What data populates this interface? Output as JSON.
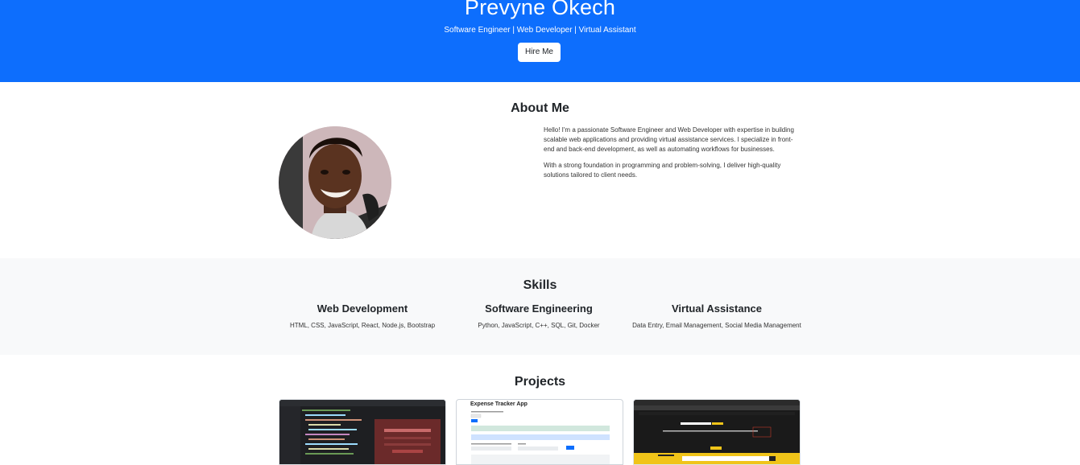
{
  "header": {
    "name": "Prevyne Okech",
    "tagline": "Software Engineer | Web Developer | Virtual Assistant",
    "hire_button": "Hire Me",
    "background_color": "#0d6efd"
  },
  "about": {
    "title": "About Me",
    "paragraph1": "Hello! I'm a passionate Software Engineer and Web Developer with expertise in building scalable web applications and providing virtual assistance services. I specialize in front-end and back-end development, as well as automating workflows for businesses.",
    "paragraph2": "With a strong foundation in programming and problem-solving, I deliver high-quality solutions tailored to client needs."
  },
  "skills": {
    "title": "Skills",
    "items": [
      {
        "name": "Web Development",
        "desc": "HTML, CSS, JavaScript, React, Node.js, Bootstrap"
      },
      {
        "name": "Software Engineering",
        "desc": "Python, JavaScript, C++, SQL, Git, Docker"
      },
      {
        "name": "Virtual Assistance",
        "desc": "Data Entry, Email Management, Social Media Management"
      }
    ]
  },
  "projects": {
    "title": "Projects",
    "items": [
      {
        "label": ""
      },
      {
        "label": "Expense Tracker App"
      },
      {
        "label": ""
      }
    ]
  }
}
